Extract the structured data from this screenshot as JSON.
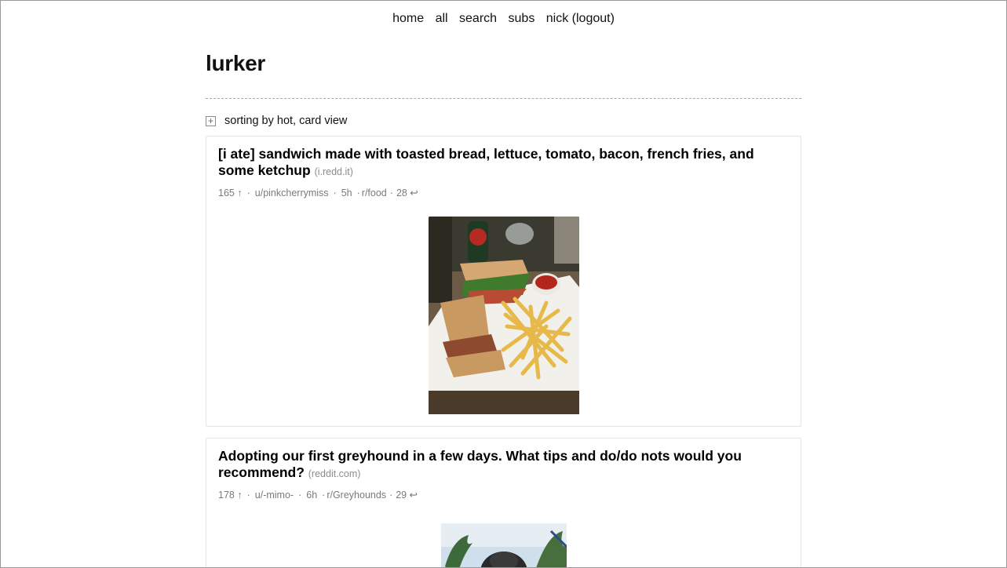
{
  "nav": {
    "home": "home",
    "all": "all",
    "search": "search",
    "subs": "subs",
    "user": "nick",
    "logout": "(logout)"
  },
  "site_title": "lurker",
  "sort_label": "sorting by hot, card view",
  "posts": [
    {
      "title": "[i ate] sandwich made with toasted bread, lettuce, tomato, bacon, french fries, and some ketchup",
      "domain": "(i.redd.it)",
      "score": "165",
      "upvote_icon": "↑",
      "author": "u/pinkcherrymiss",
      "age": "5h",
      "subreddit": "r/food",
      "comments": "28",
      "reply_icon": "↩"
    },
    {
      "title": "Adopting our first greyhound in a few days. What tips and do/do nots would you recommend?",
      "domain": "(reddit.com)",
      "score": "178",
      "upvote_icon": "↑",
      "author": "u/-mimo-",
      "age": "6h",
      "subreddit": "r/Greyhounds",
      "comments": "29",
      "reply_icon": "↩"
    }
  ],
  "colors": {
    "text": "#111111",
    "muted": "#7a7a7a",
    "card_border": "#e4e4e4",
    "divider": "#a8a8a8"
  }
}
